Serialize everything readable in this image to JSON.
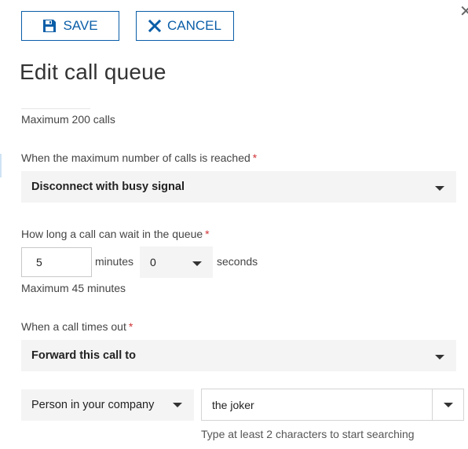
{
  "toolbar": {
    "save_label": "SAVE",
    "cancel_label": "CANCEL",
    "save_icon": "floppy-disk-icon",
    "cancel_icon": "x-icon",
    "close_icon": "close-icon",
    "close_glyph": "✕",
    "accent_color": "#0a5ea8"
  },
  "page": {
    "title": "Edit call queue"
  },
  "max_calls": {
    "hint": "Maximum 200 calls"
  },
  "max_calls_action": {
    "label": "When the maximum number of calls is reached",
    "required_mark": "*",
    "selected": "Disconnect with busy signal"
  },
  "wait_time": {
    "label": "How long a call can wait in the queue",
    "required_mark": "*",
    "minutes_value": "5",
    "minutes_unit": "minutes",
    "seconds_value": "0",
    "seconds_unit": "seconds",
    "hint": "Maximum 45 minutes"
  },
  "timeout_action": {
    "label": "When a call times out",
    "required_mark": "*",
    "selected": "Forward this call to"
  },
  "forward_target": {
    "type_selected": "Person in your company",
    "search_value": "the joker",
    "search_hint": "Type at least 2 characters to start searching"
  },
  "colors": {
    "required": "#d13438",
    "select_bg": "#f4f4f4"
  }
}
